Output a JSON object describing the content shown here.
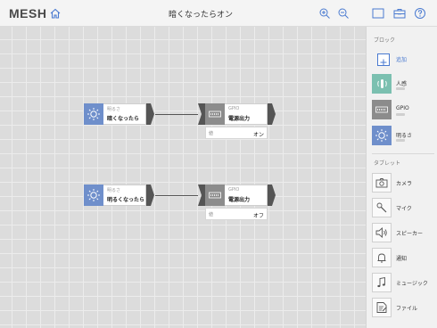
{
  "app": {
    "logo": "MESH",
    "title": "暗くなったらオン"
  },
  "colors": {
    "sensor_block": "#6f8fcb",
    "gpio_block": "#8c8c8c",
    "human_block": "#7bc0b0",
    "accent": "#4a7ad0"
  },
  "recipes": [
    {
      "sensor": {
        "category": "明るさ",
        "name": "暗くなったら"
      },
      "actuator": {
        "category": "GPIO",
        "name": "電源出力",
        "param_label": "値",
        "param_value": "オン"
      }
    },
    {
      "sensor": {
        "category": "明るさ",
        "name": "明るくなったら"
      },
      "actuator": {
        "category": "GPIO",
        "name": "電源出力",
        "param_label": "値",
        "param_value": "オフ"
      }
    }
  ],
  "sidebar": {
    "blocks_title": "ブロック",
    "add_label": "追加",
    "blocks": [
      {
        "label": "人感",
        "icon": "motion-sensor-icon"
      },
      {
        "label": "GPIO",
        "icon": "gpio-icon"
      },
      {
        "label": "明るさ",
        "icon": "brightness-icon"
      }
    ],
    "tablet_title": "タブレット",
    "tablet": [
      {
        "label": "カメラ",
        "icon": "camera-icon"
      },
      {
        "label": "マイク",
        "icon": "microphone-icon"
      },
      {
        "label": "スピーカー",
        "icon": "speaker-icon"
      },
      {
        "label": "通知",
        "icon": "bell-icon"
      },
      {
        "label": "ミュージック",
        "icon": "music-note-icon"
      },
      {
        "label": "ファイル",
        "icon": "file-icon"
      }
    ]
  }
}
